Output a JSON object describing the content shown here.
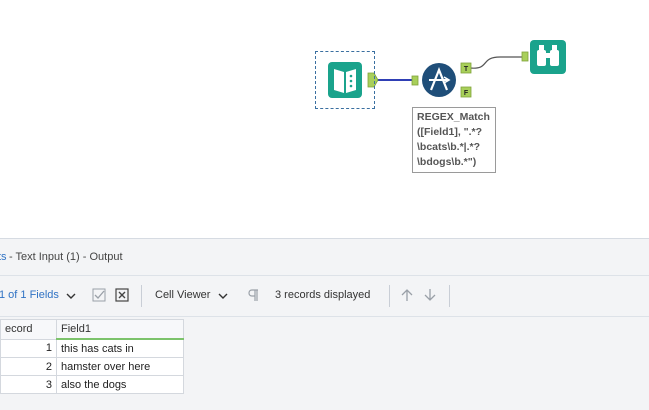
{
  "canvas": {
    "annotation": "REGEX_Match\n([Field1], \".*?\n\\bcats\\b.*|.*?\n\\bdogs\\b.*\")",
    "filter_true_label": "T",
    "filter_false_label": "F",
    "colors": {
      "tool_teal": "#1aa38c",
      "filter_blue": "#1f4e79",
      "anchor_green": "#a8cf5a",
      "connection_blue": "#2f3fb5"
    }
  },
  "results": {
    "title_prefix": "ts",
    "title_suffix": " - Text Input (1) - Output",
    "toolbar": {
      "fields_selector": "1 of 1 Fields",
      "viewer_selector": "Cell Viewer",
      "records_status": "3 records displayed"
    },
    "table": {
      "headers": [
        "ecord",
        "Field1"
      ],
      "rows": [
        {
          "record": "1",
          "field1": "this has cats in"
        },
        {
          "record": "2",
          "field1": "hamster over here"
        },
        {
          "record": "3",
          "field1": "also the dogs"
        }
      ]
    }
  }
}
